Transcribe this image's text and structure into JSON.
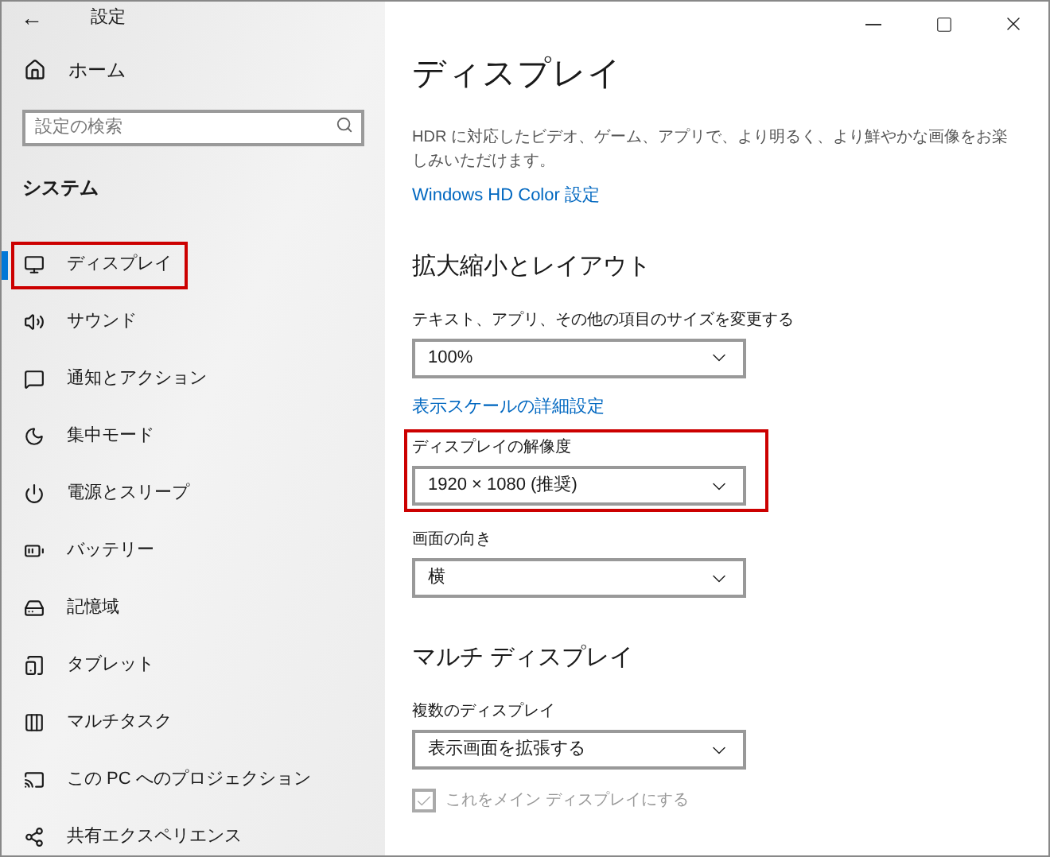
{
  "window": {
    "title": "設定",
    "back": "←"
  },
  "sidebar": {
    "home": "ホーム",
    "search": {
      "placeholder": "設定の検索"
    },
    "section": "システム",
    "items": [
      {
        "label": "ディスプレイ",
        "selected": true,
        "highlighted": true
      },
      {
        "label": "サウンド",
        "selected": false,
        "highlighted": false
      },
      {
        "label": "通知とアクション",
        "selected": false,
        "highlighted": false
      },
      {
        "label": "集中モード",
        "selected": false,
        "highlighted": false
      },
      {
        "label": "電源とスリープ",
        "selected": false,
        "highlighted": false
      },
      {
        "label": "バッテリー",
        "selected": false,
        "highlighted": false
      },
      {
        "label": "記憶域",
        "selected": false,
        "highlighted": false
      },
      {
        "label": "タブレット",
        "selected": false,
        "highlighted": false
      },
      {
        "label": "マルチタスク",
        "selected": false,
        "highlighted": false
      },
      {
        "label": "この PC へのプロジェクション",
        "selected": false,
        "highlighted": false
      },
      {
        "label": "共有エクスペリエンス",
        "selected": false,
        "highlighted": false
      }
    ]
  },
  "content": {
    "title": "ディスプレイ",
    "hdr_text": "HDR に対応したビデオ、ゲーム、アプリで、より明るく、より鮮やかな画像をお楽しみいただけます。",
    "hdr_link": "Windows HD Color 設定",
    "sections": [
      {
        "heading": "拡大縮小とレイアウト",
        "items": [
          {
            "kind": "dropdown",
            "label": "テキスト、アプリ、その他の項目のサイズを変更する",
            "value": "100%",
            "highlighted": false
          },
          {
            "kind": "link",
            "label": "表示スケールの詳細設定"
          },
          {
            "kind": "dropdown",
            "label": "ディスプレイの解像度",
            "value": "1920 × 1080 (推奨)",
            "highlighted": true
          },
          {
            "kind": "dropdown",
            "label": "画面の向き",
            "value": "横",
            "highlighted": false
          }
        ]
      },
      {
        "heading": "マルチ ディスプレイ",
        "items": [
          {
            "kind": "dropdown",
            "label": "複数のディスプレイ",
            "value": "表示画面を拡張する",
            "highlighted": false
          },
          {
            "kind": "checkbox",
            "label": "これをメイン ディスプレイにする",
            "checked": true,
            "disabled": true
          }
        ]
      }
    ]
  }
}
